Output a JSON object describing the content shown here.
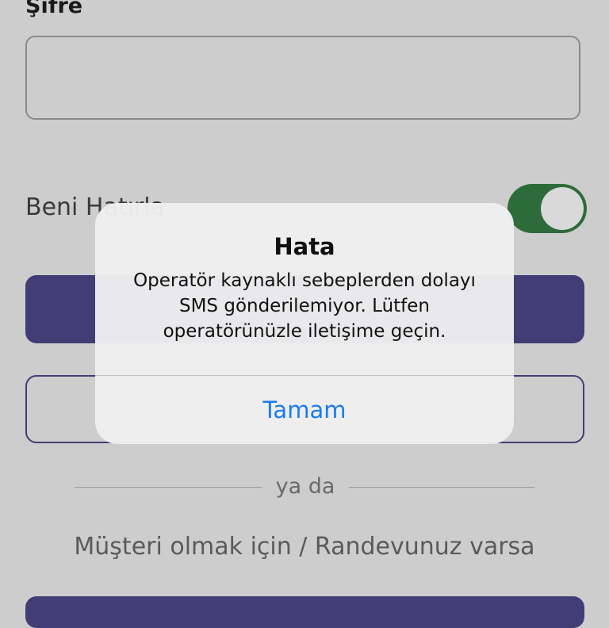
{
  "form": {
    "password_label": "Şifre",
    "remember_label": "Beni Hatırla",
    "remember_toggle_on": true,
    "divider_text": "ya da",
    "customer_link": "Müşteri olmak için / Randevunuz varsa"
  },
  "alert": {
    "title": "Hata",
    "message": "Operatör kaynaklı sebeplerden dolayı SMS gönderilemiyor. Lütfen operatörünüzle iletişime geçin.",
    "button_label": "Tamam"
  },
  "colors": {
    "primary": "#423d74",
    "toggle_on": "#2e6b3a",
    "link": "#1a7cf0"
  }
}
